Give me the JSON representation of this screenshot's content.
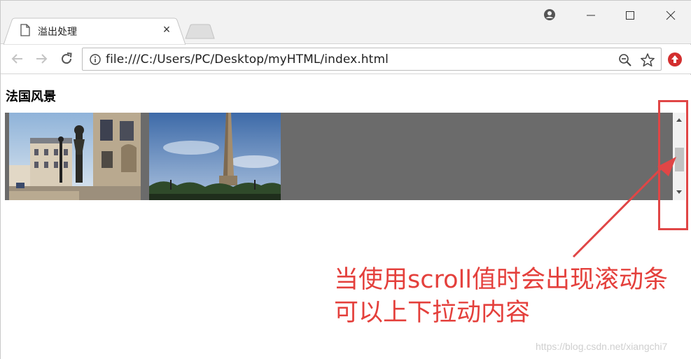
{
  "tab": {
    "title": "溢出处理",
    "close_glyph": "×"
  },
  "toolbar": {
    "url": "file:///C:/Users/PC/Desktop/myHTML/index.html"
  },
  "page": {
    "heading": "法国风景"
  },
  "annotation": {
    "line1": "当使用scroll值时会出现滚动条",
    "line2": "可以上下拉动内容",
    "color": "#e4403c"
  },
  "watermark": "https://blog.csdn.net/xiangchi7",
  "colors": {
    "scroll_box_bg": "#6b6b6b",
    "highlight": "#e04646"
  },
  "icons": {
    "tab": "document-icon",
    "new_tab": "new-tab-icon",
    "profile": "profile-icon",
    "back": "back-arrow-icon",
    "forward": "forward-arrow-icon",
    "reload": "reload-icon",
    "info": "info-icon",
    "zoom": "zoom-out-icon",
    "bookmark": "star-icon",
    "extension": "extension-icon"
  }
}
